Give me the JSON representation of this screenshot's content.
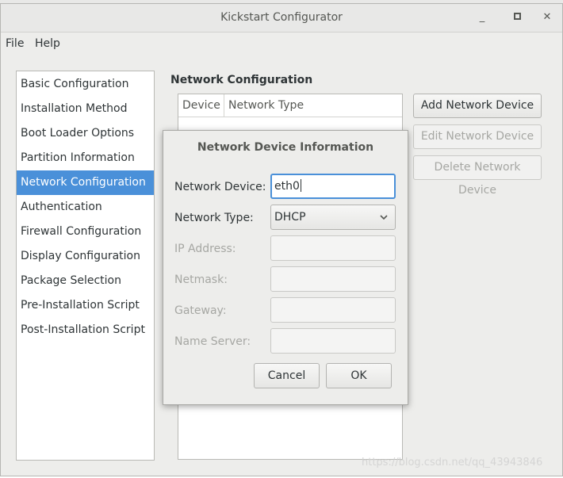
{
  "window": {
    "title": "Kickstart Configurator",
    "minimize_glyph": "_",
    "close_glyph": "✕"
  },
  "menubar": {
    "file": "File",
    "help": "Help"
  },
  "sidebar": {
    "selected_index": 4,
    "items": [
      {
        "label": "Basic Configuration"
      },
      {
        "label": "Installation Method"
      },
      {
        "label": "Boot Loader Options"
      },
      {
        "label": "Partition Information"
      },
      {
        "label": "Network Configuration"
      },
      {
        "label": "Authentication"
      },
      {
        "label": "Firewall Configuration"
      },
      {
        "label": "Display Configuration"
      },
      {
        "label": "Package Selection"
      },
      {
        "label": "Pre-Installation Script"
      },
      {
        "label": "Post-Installation Script"
      }
    ]
  },
  "main": {
    "section_title": "Network Configuration",
    "table": {
      "columns": [
        "Device",
        "Network Type"
      ]
    },
    "buttons": {
      "add": "Add Network Device",
      "edit": "Edit Network Device",
      "delete": "Delete Network Device"
    }
  },
  "dialog": {
    "title": "Network Device Information",
    "fields": {
      "network_device": {
        "label": "Network Device:",
        "value": "eth0"
      },
      "network_type": {
        "label": "Network Type:",
        "value": "DHCP"
      },
      "ip_address": {
        "label": "IP Address:",
        "value": ""
      },
      "netmask": {
        "label": "Netmask:",
        "value": ""
      },
      "gateway": {
        "label": "Gateway:",
        "value": ""
      },
      "name_server": {
        "label": "Name Server:",
        "value": ""
      }
    },
    "buttons": {
      "cancel": "Cancel",
      "ok": "OK"
    }
  },
  "watermark": "https://blog.csdn.net/qq_43943846",
  "colors": {
    "selection": "#4a90d9",
    "focus": "#4a90d9",
    "disabled_text": "#a6a7a3"
  }
}
